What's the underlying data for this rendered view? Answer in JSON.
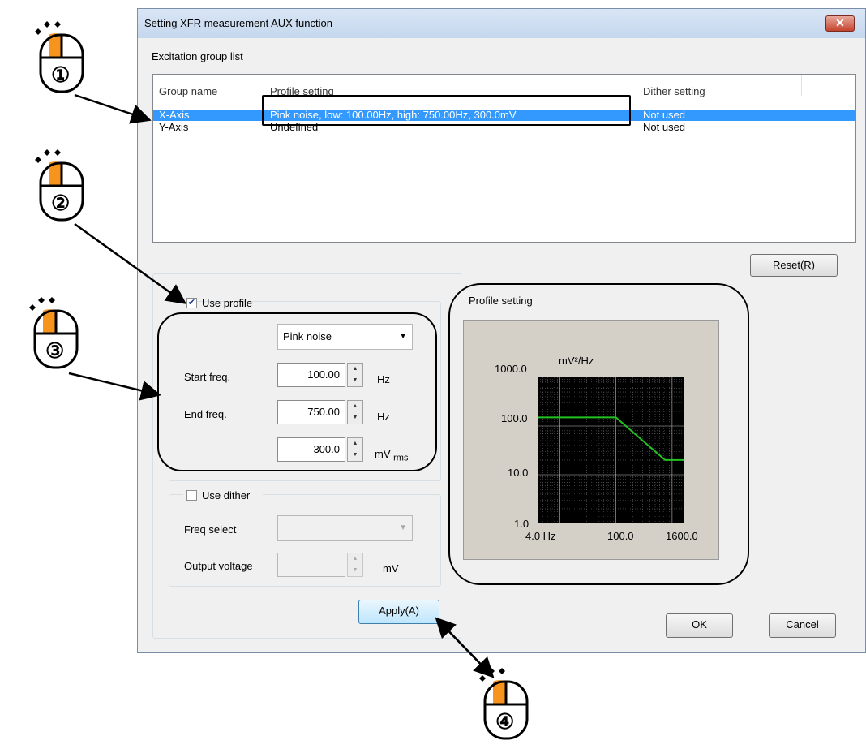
{
  "window": {
    "title": "Setting XFR measurement AUX function",
    "close_label": "✕"
  },
  "excitation": {
    "label": "Excitation group list",
    "columns": [
      "Group name",
      "Profile setting",
      "Dither setting"
    ],
    "rows": [
      {
        "name": "X-Axis",
        "profile": "Pink noise, low: 100.00Hz, high: 750.00Hz, 300.0mV",
        "dither": "Not used",
        "selected": true
      },
      {
        "name": "Y-Axis",
        "profile": "Undefined",
        "dither": "Not used",
        "selected": false
      }
    ]
  },
  "reset_label": "Reset(R)",
  "profile": {
    "use_label": "Use profile",
    "checked": true,
    "type": "Pink noise",
    "start_label": "Start freq.",
    "start_value": "100.00",
    "start_unit": "Hz",
    "end_label": "End freq.",
    "end_value": "750.00",
    "end_unit": "Hz",
    "level_value": "300.0",
    "level_unit": "mV",
    "level_unit_sub": "rms"
  },
  "dither": {
    "use_label": "Use dither",
    "checked": false,
    "freq_label": "Freq select",
    "freq_value": "",
    "voltage_label": "Output voltage",
    "voltage_value": "",
    "voltage_unit": "mV"
  },
  "apply_label": "Apply(A)",
  "ok_label": "OK",
  "cancel_label": "Cancel",
  "chart_title": "Profile setting",
  "chart_data": {
    "type": "line",
    "title": "Profile setting",
    "ylabel": "mV²/Hz",
    "xscale": "log",
    "yscale": "log",
    "xlim": [
      4.0,
      1600.0
    ],
    "ylim": [
      1.0,
      1000.0
    ],
    "x_ticks": [
      "4.0 Hz",
      "100.0",
      "1600.0"
    ],
    "y_ticks": [
      "1000.0",
      "100.0",
      "10.0",
      "1.0"
    ],
    "series": [
      {
        "x": [
          4.0,
          100.0,
          750.0,
          1600.0
        ],
        "y": [
          150,
          150,
          20,
          20
        ],
        "color": "#22c222"
      }
    ],
    "grid": true
  },
  "annotations": [
    "①",
    "②",
    "③",
    "④"
  ],
  "colors": {
    "selection": "#3399ff",
    "mouse_button": "#f7941d",
    "line": "#22c222"
  }
}
